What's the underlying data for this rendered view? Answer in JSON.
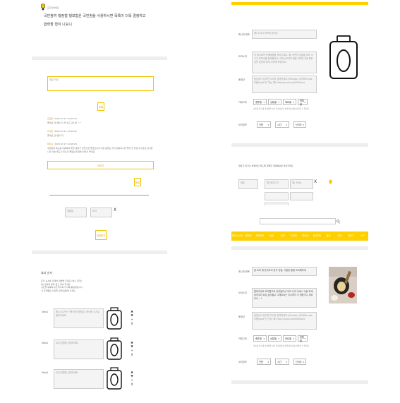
{
  "left": {
    "header": {
      "badge": "로그인하세요",
      "line1": "국민참여 행정협 행보함은 국민참을 사용하시면 목록이 더욱 결정하고",
      "line2": "협력할 형이 니요니"
    },
    "comment": {
      "placeholder": "댓글 작성",
      "submit": "등록",
      "entries": [
        {
          "author": "김민준",
          "date": "2023.07.27 11:45:16",
          "text": "좋네요 감사합니다 잘 보고 갑니다 ^^"
        },
        {
          "author": "이서연",
          "date": "2023.07.27 11:46:02",
          "text": "좋네요 감사합니다"
        },
        {
          "author": "박지훈",
          "date": "2023.07.27 11:48:20",
          "text": "국민참여 제도를 이용하여 좋은 결과가 있었으면 좋겠습니다 다른 분들도 많이 참여하시면 좋을 것 같습니다 항상 감사합니다 이런 제도가 있는지 몰랐는데 알게 되어서 좋네요"
        }
      ],
      "more": "더보기",
      "reply_btn": "등록"
    },
    "search": {
      "field1": "출발일",
      "field2": "도착",
      "x": "X",
      "btn": "검색하기"
    },
    "steps": {
      "title": "요리 순서",
      "desc1": "요리 순서를 자세히 설명해 주세요 (필수 입력)",
      "desc2": "예) 냄비에 물을 붓고 끓여 주세요",
      "desc3": "사진을 등록하시면 레시피가 더욱 풍성해집니다",
      "desc4": "각 단계별로 사진을 함께 등록해 주세요",
      "items": [
        {
          "label": "Step1",
          "placeholder": "예) 소고기는 기름기를 떼어내고 적당한 크기로 썰어주세요."
        },
        {
          "label": "Step2",
          "placeholder": "요리 방법을 입력하세요."
        },
        {
          "label": "Step3",
          "placeholder": "요리 방법을 입력하세요."
        }
      ],
      "ctrl": [
        "▲",
        "▼",
        "+",
        "X"
      ]
    }
  },
  "right": {
    "form1": {
      "title_label": "레시피 제목",
      "title_ph": "예) 소고기 미역국 끓이기",
      "intro_label": "요리소개",
      "intro_ph": "이 레시피의 탄생배경을 적어주세요. 예) 남편의 생일을 맞아 소고기 미역국을 끓여봤어요. 어머니로부터 배운 미역국 레시피를 남편 입맛에 맞게 고안해 보았어요.",
      "video_label": "동영상",
      "video_ph": "동영상이 있으면 주소를 입력하세요.(Youtube, 네이버tvcast 다음tvpot 만 가능) 예) http://youtu.be/lA0Bxxxx",
      "cat_label": "카테고리",
      "cats": [
        "종류별",
        "상황별",
        "재료별",
        "방법별"
      ],
      "cat_note": "분류를 바르게 설정해주시면, 이용자들이 쉽게 레시피를 검색할 수 있어요.",
      "info_label": "요리정보",
      "info": [
        "인원",
        "시간",
        "난이도"
      ]
    },
    "ingredients": {
      "desc": "재료가 남거나 부족하지 않도록 정확한 계량정보를 적어주세요.",
      "field1": "재료",
      "field2": "예) 돼지고기",
      "field3": "예) 300g",
      "x": "X"
    },
    "tabs": [
      "전체 레시피",
      "밑반찬",
      "메인반찬",
      "국/탕",
      "찌개",
      "디저트",
      "면/만두",
      "밥/죽/떡",
      "퓨전",
      "양식",
      "샐러드",
      "스프"
    ],
    "form2": {
      "title_label": "레시피 제목",
      "title_val": "밥 요리 볶 한국요리 한국 전통, 사람한 통합 요리해하세",
      "intro_label": "요리소개",
      "intro_val": "알려주네요 요리법으로 흘러들어서 우리 나의 국내스 사랑 하세네이우리 요금 숨어들고 그래요요는 다시하지 가 제합기니 세요요나 ...!",
      "video_label": "동영상",
      "video_ph": "동영상이 있으면 주소를 입력하세요.(Youtube, 네이버tvcast 다음tvpot 만 가능) 예) http://youtu.be/lA0Bxxxx",
      "cat_label": "카테고리",
      "cats": [
        "종류별",
        "상황별",
        "재료별",
        "방법별"
      ],
      "cat_note": "분류를 바르게 설정해주시면, 이용자들이 쉽게 레시피를 검색할 수 있어요.",
      "info_label": "요리정보",
      "info": [
        "인원",
        "시간",
        "난이도"
      ]
    }
  },
  "colors": {
    "accent": "#ffd000",
    "accent_text": "#d0a000",
    "sep": "#eeeeee"
  }
}
